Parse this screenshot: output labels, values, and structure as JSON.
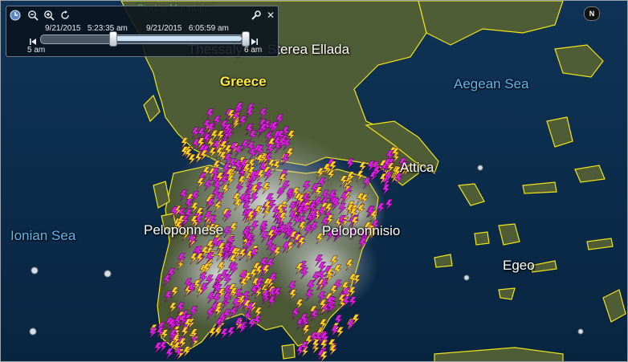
{
  "map": {
    "labels": {
      "country": "Greece",
      "region_thessaly": "Thessaly",
      "region_sterea": "Sterea Ellada",
      "region_attica": "Attica",
      "region_peloponnese": "Peloponnese",
      "region_ionian_isl": "Peloponnisio",
      "sea_aegean": "Aegean Sea",
      "sea_ionian": "Ionian Sea",
      "sea_egeo": "Egeo",
      "mountains": "Pindus Mountains"
    },
    "colors": {
      "sea": "#0b2c4a",
      "land": "#4b5a35",
      "border": "#f2e419",
      "bolt_magenta": "#e21de6",
      "bolt_yellow": "#ffd21a"
    }
  },
  "time_slider": {
    "start_date": "9/21/2015",
    "start_time": "5:23:35 am",
    "end_date": "9/21/2015",
    "end_time": "6:05:59 am",
    "range_start_label": "5 am",
    "range_end_label": "6 am",
    "selection_start_fraction": 0.36,
    "selection_end_fraction": 1.0
  },
  "controls": {
    "clock_icon": "clock-icon",
    "zoom_out_icon": "zoom-out-icon",
    "zoom_in_icon": "zoom-in-icon",
    "refresh_icon": "refresh-icon",
    "settings_icon": "wrench-icon",
    "close_label": "✕",
    "compass_label": "N"
  }
}
